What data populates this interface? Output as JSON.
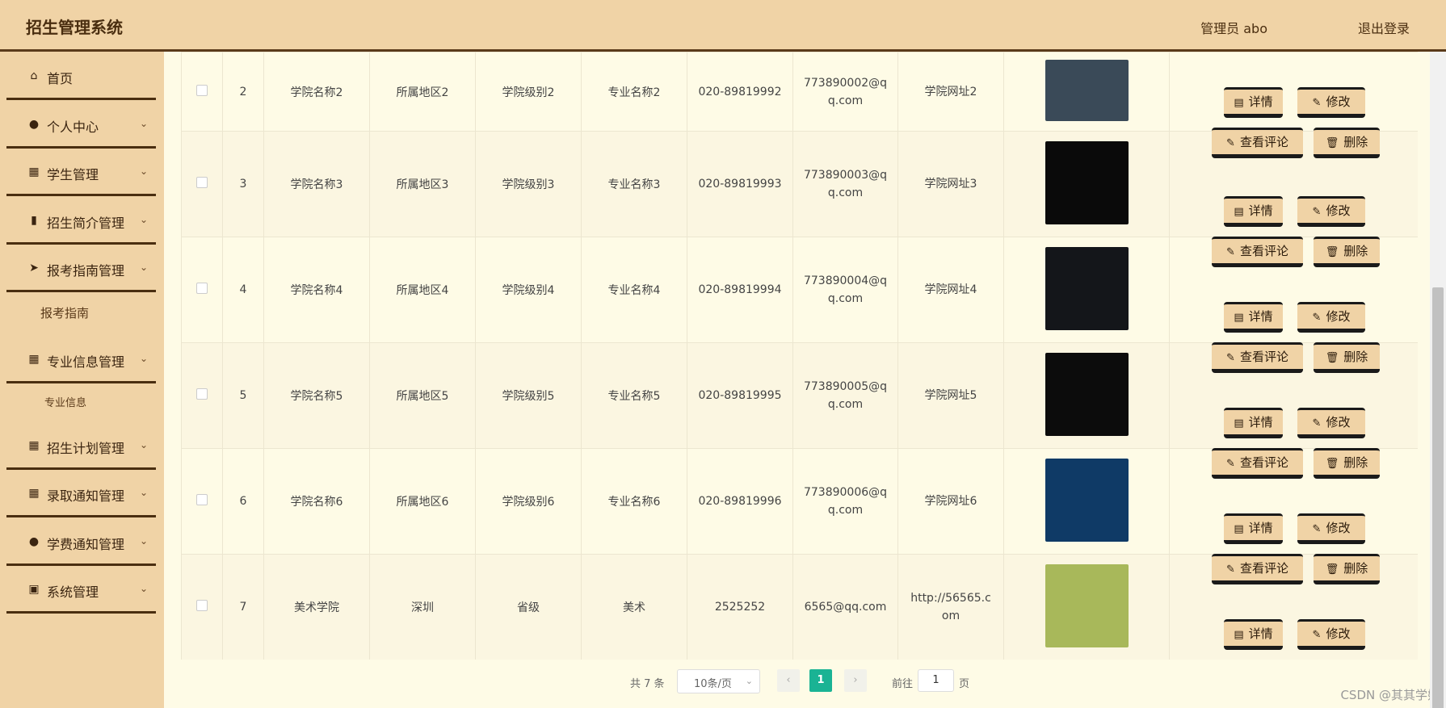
{
  "header": {
    "title": "招生管理系统",
    "user": "管理员 abo",
    "logout": "退出登录"
  },
  "sidebar": {
    "items": [
      {
        "label": "首页",
        "icon": "home-icon"
      },
      {
        "label": "个人中心",
        "icon": "user-icon"
      },
      {
        "label": "学生管理",
        "icon": "grid-icon"
      },
      {
        "label": "招生简介管理",
        "icon": "bar-chart-icon"
      },
      {
        "label": "报考指南管理",
        "icon": "send-icon"
      },
      {
        "label": "专业信息管理",
        "icon": "grid-icon"
      },
      {
        "label": "招生计划管理",
        "icon": "grid-icon"
      },
      {
        "label": "录取通知管理",
        "icon": "grid-icon"
      },
      {
        "label": "学费通知管理",
        "icon": "bulb-icon"
      },
      {
        "label": "系统管理",
        "icon": "clipboard-icon"
      }
    ],
    "subitems": {
      "guide": "报考指南",
      "major": "专业信息"
    }
  },
  "actions": {
    "detail": "详情",
    "edit": "修改",
    "comments": "查看评论",
    "delete": "删除"
  },
  "rows": [
    {
      "idx": "2",
      "name": "学院名称2",
      "region": "所属地区2",
      "level": "学院级别2",
      "major": "专业名称2",
      "phone": "020-89819992",
      "email": "773890002@qq.com",
      "site": "学院网址2",
      "img_color": "#3a4a58"
    },
    {
      "idx": "3",
      "name": "学院名称3",
      "region": "所属地区3",
      "level": "学院级别3",
      "major": "专业名称3",
      "phone": "020-89819993",
      "email": "773890003@qq.com",
      "site": "学院网址3",
      "img_color": "#0a0a0a"
    },
    {
      "idx": "4",
      "name": "学院名称4",
      "region": "所属地区4",
      "level": "学院级别4",
      "major": "专业名称4",
      "phone": "020-89819994",
      "email": "773890004@qq.com",
      "site": "学院网址4",
      "img_color": "#14161a"
    },
    {
      "idx": "5",
      "name": "学院名称5",
      "region": "所属地区5",
      "level": "学院级别5",
      "major": "专业名称5",
      "phone": "020-89819995",
      "email": "773890005@qq.com",
      "site": "学院网址5",
      "img_color": "#0c0c0c"
    },
    {
      "idx": "6",
      "name": "学院名称6",
      "region": "所属地区6",
      "level": "学院级别6",
      "major": "专业名称6",
      "phone": "020-89819996",
      "email": "773890006@qq.com",
      "site": "学院网址6",
      "img_color": "#0f3a66"
    },
    {
      "idx": "7",
      "name": "美术学院",
      "region": "深圳",
      "level": "省级",
      "major": "美术",
      "phone": "2525252",
      "email": "6565@qq.com",
      "site": "http://56565.com",
      "img_color": "#a8b85a"
    }
  ],
  "pager": {
    "total": "共 7 条",
    "page_size": "10条/页",
    "current": "1",
    "goto": "前往",
    "goto_value": "1",
    "page_suffix": "页"
  },
  "watermark": "CSDN @其其学姐"
}
